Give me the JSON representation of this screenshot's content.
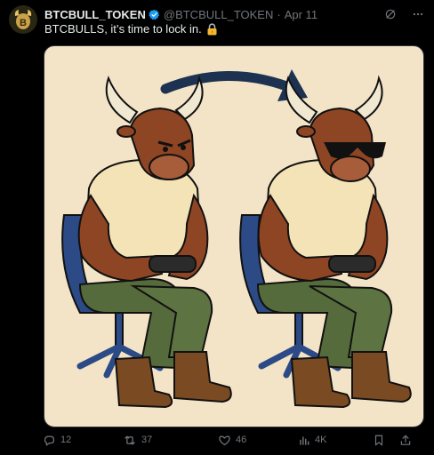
{
  "tweet": {
    "display_name": "BTCBULL_TOKEN",
    "handle": "@BTCBULL_TOKEN",
    "separator": "·",
    "date": "Apr 11",
    "text": "BTCBULLS, it’s time to lock in.",
    "avatar_letter": "B"
  },
  "icons": {
    "verified": "verified-badge-icon",
    "grok": "grok-icon",
    "more": "more-icon",
    "lock": "lock-emoji-icon",
    "reply": "reply-icon",
    "retweet": "retweet-icon",
    "like": "like-icon",
    "views": "views-icon",
    "bookmark": "bookmark-icon",
    "share": "share-icon"
  },
  "metrics": {
    "replies": "12",
    "retweets": "37",
    "likes": "46",
    "views": "4K"
  },
  "colors": {
    "background": "#000000",
    "text": "#e7e9ea",
    "secondary": "#71767b",
    "verified": "#1d9bf0",
    "image_bg": "#f3e4c7"
  }
}
